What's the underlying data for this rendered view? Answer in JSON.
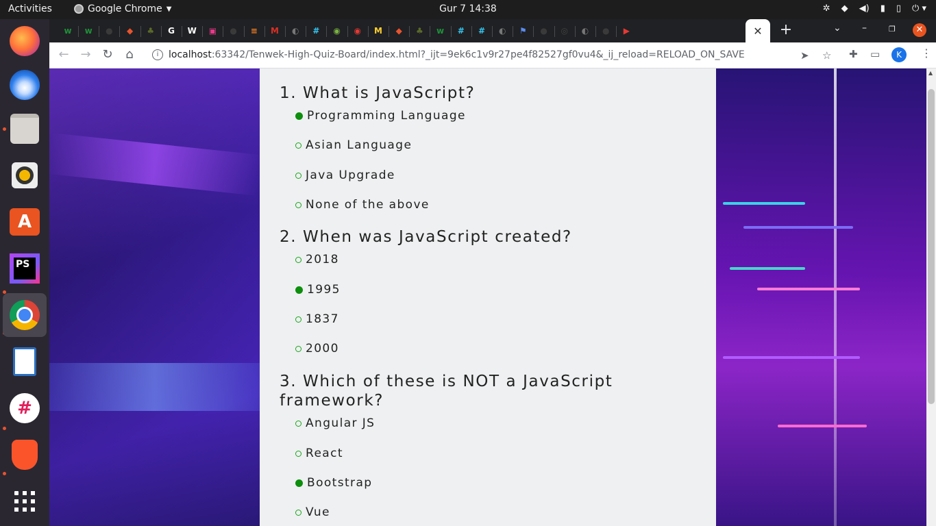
{
  "system_bar": {
    "activities": "Activities",
    "app_name": "Google Chrome",
    "clock": "Gur 7  14:38"
  },
  "browser": {
    "url_host": "localhost",
    "url_rest": ":63342/Tenwek-High-Quiz-Board/index.html?_ijt=9ek6c1v9r27pe4f82527gf0vu4&_ij_reload=RELOAD_ON_SAVE",
    "profile_initial": "K",
    "active_tab_close": "✕",
    "new_tab": "+",
    "tabs": [
      {
        "name": "webflow-tab",
        "glyph": "w",
        "color": "#1f8f3a"
      },
      {
        "name": "webflow-tab-2",
        "glyph": "w",
        "color": "#1f8f3a"
      },
      {
        "name": "github-tab",
        "glyph": "●",
        "color": "#3a3a3a"
      },
      {
        "name": "figma-tab",
        "glyph": "◆",
        "color": "#e8542d"
      },
      {
        "name": "tree-tab",
        "glyph": "♣",
        "color": "#5a6b2a"
      },
      {
        "name": "google-tab",
        "glyph": "G",
        "color": "#ffffff"
      },
      {
        "name": "wikipedia-tab",
        "glyph": "W",
        "color": "#ffffff"
      },
      {
        "name": "pink-tab",
        "glyph": "▣",
        "color": "#e83a8a"
      },
      {
        "name": "github-tab-2",
        "glyph": "●",
        "color": "#3a3a3a"
      },
      {
        "name": "stack-tab",
        "glyph": "≡",
        "color": "#f48024"
      },
      {
        "name": "gmail-tab",
        "glyph": "M",
        "color": "#d93025"
      },
      {
        "name": "globe-tab",
        "glyph": "◐",
        "color": "#777"
      },
      {
        "name": "slack-tab",
        "glyph": "#",
        "color": "#36c5f0"
      },
      {
        "name": "green-tab",
        "glyph": "◉",
        "color": "#7cb342"
      },
      {
        "name": "record-tab",
        "glyph": "◉",
        "color": "#e53935"
      },
      {
        "name": "miro-tab",
        "glyph": "M",
        "color": "#ffd02f"
      },
      {
        "name": "figma-tab-2",
        "glyph": "◆",
        "color": "#e8542d"
      },
      {
        "name": "tree-tab-2",
        "glyph": "♣",
        "color": "#5a6b2a"
      },
      {
        "name": "webflow-tab-3",
        "glyph": "w",
        "color": "#1f8f3a"
      },
      {
        "name": "slack-tab-2",
        "glyph": "#",
        "color": "#36c5f0"
      },
      {
        "name": "slack-tab-3",
        "glyph": "#",
        "color": "#36c5f0"
      },
      {
        "name": "globe-tab-2",
        "glyph": "◐",
        "color": "#777"
      },
      {
        "name": "flag-tab",
        "glyph": "⚑",
        "color": "#5b8def"
      },
      {
        "name": "github-tab-3",
        "glyph": "●",
        "color": "#3a3a3a"
      },
      {
        "name": "dim-tab",
        "glyph": "◎",
        "color": "#444"
      },
      {
        "name": "globe-tab-3",
        "glyph": "◐",
        "color": "#777"
      },
      {
        "name": "github-tab-4",
        "glyph": "●",
        "color": "#3a3a3a"
      },
      {
        "name": "youtube-music-tab",
        "glyph": "▶",
        "color": "#e53935"
      }
    ]
  },
  "quiz": {
    "questions": [
      {
        "text": "1. What is JavaScript?",
        "options": [
          {
            "label": "Programming Language",
            "selected": true
          },
          {
            "label": "Asian Language",
            "selected": false
          },
          {
            "label": "Java Upgrade",
            "selected": false
          },
          {
            "label": "None of the above",
            "selected": false
          }
        ]
      },
      {
        "text": "2. When was JavaScript created?",
        "options": [
          {
            "label": "2018",
            "selected": false
          },
          {
            "label": "1995",
            "selected": true
          },
          {
            "label": "1837",
            "selected": false
          },
          {
            "label": "2000",
            "selected": false
          }
        ]
      },
      {
        "text": "3. Which of these is NOT a JavaScript framework?",
        "options": [
          {
            "label": "Angular JS",
            "selected": false
          },
          {
            "label": "React",
            "selected": false
          },
          {
            "label": "Bootstrap",
            "selected": true
          },
          {
            "label": "Vue",
            "selected": false
          }
        ]
      }
    ]
  },
  "colors": {
    "selected_radio": "#0d8f0d",
    "radio_border": "#1aa51a",
    "card_bg": "#eef0f1",
    "ubuntu_orange": "#e95420"
  }
}
